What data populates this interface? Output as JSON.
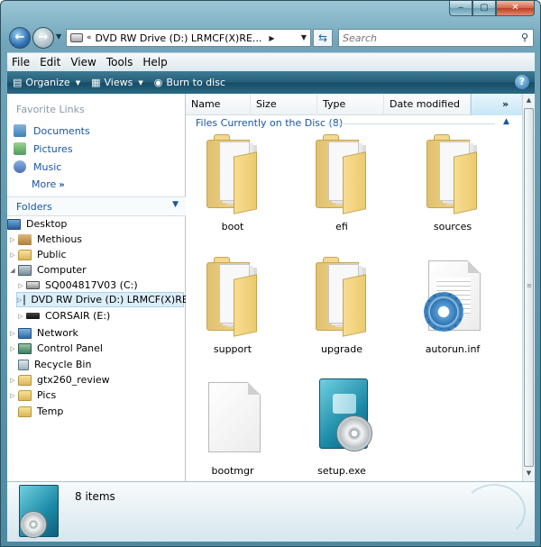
{
  "window": {
    "min": "‒",
    "max": "▢",
    "close": "✕"
  },
  "address": {
    "path": "DVD RW Drive (D:) LRMCF(X)RE...",
    "arrows": "«"
  },
  "search": {
    "placeholder": "Search"
  },
  "menu": [
    "File",
    "Edit",
    "View",
    "Tools",
    "Help"
  ],
  "commands": {
    "organize": "Organize",
    "views": "Views",
    "burn": "Burn to disc",
    "help": "?"
  },
  "nav": {
    "favorites_title": "Favorite Links",
    "favorites": [
      "Documents",
      "Pictures",
      "Music"
    ],
    "more": "More",
    "more_arrows": "»",
    "folders_title": "Folders",
    "tree": [
      {
        "label": "Desktop",
        "icon": "desktop-icon"
      },
      {
        "label": "Methious",
        "icon": "user-folder-icon"
      },
      {
        "label": "Public",
        "icon": "folder-icon"
      },
      {
        "label": "Computer",
        "icon": "computer-icon"
      },
      {
        "label": "SQ004817V03 (C:)",
        "icon": "hard-drive-icon"
      },
      {
        "label": "DVD RW Drive (D:) LRMCF(X)RE_",
        "icon": "dvd-drive-icon",
        "selected": true
      },
      {
        "label": "CORSAIR (E:)",
        "icon": "usb-drive-icon"
      },
      {
        "label": "Network",
        "icon": "network-icon"
      },
      {
        "label": "Control Panel",
        "icon": "control-panel-icon"
      },
      {
        "label": "Recycle Bin",
        "icon": "recycle-bin-icon"
      },
      {
        "label": "gtx260_review",
        "icon": "folder-icon"
      },
      {
        "label": "Pics",
        "icon": "folder-icon"
      },
      {
        "label": "Temp",
        "icon": "folder-icon"
      }
    ]
  },
  "columns": [
    "Name",
    "Size",
    "Type",
    "Date modified",
    "»"
  ],
  "group_header": "Files Currently on the Disc (8)",
  "files": [
    {
      "name": "boot",
      "icon": "folder-icon"
    },
    {
      "name": "efi",
      "icon": "folder-icon"
    },
    {
      "name": "sources",
      "icon": "folder-icon"
    },
    {
      "name": "support",
      "icon": "folder-icon"
    },
    {
      "name": "upgrade",
      "icon": "folder-icon"
    },
    {
      "name": "autorun.inf",
      "icon": "settings-file-icon"
    },
    {
      "name": "bootmgr",
      "icon": "blank-file-icon"
    },
    {
      "name": "setup.exe",
      "icon": "setup-icon"
    }
  ],
  "details": {
    "count": "8 items"
  }
}
